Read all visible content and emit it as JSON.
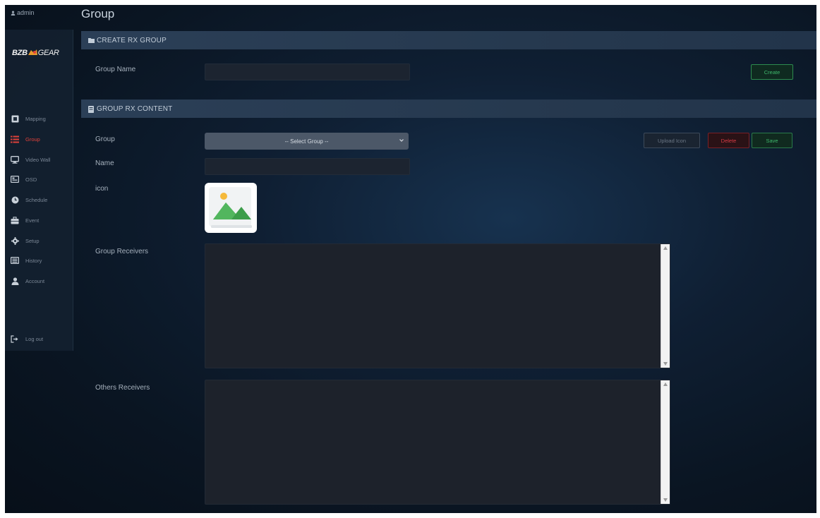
{
  "header": {
    "user": "admin",
    "page_title": "Group"
  },
  "brand": {
    "logo_part1": "BZB",
    "logo_part3": "GEAR"
  },
  "sidebar": {
    "items": [
      {
        "label": "Mapping",
        "icon": "mapping-icon"
      },
      {
        "label": "Group",
        "icon": "list-icon",
        "active": true
      },
      {
        "label": "Video Wall",
        "icon": "monitor-icon"
      },
      {
        "label": "OSD",
        "icon": "osd-icon"
      },
      {
        "label": "Schedule",
        "icon": "clock-icon"
      },
      {
        "label": "Event",
        "icon": "briefcase-icon"
      },
      {
        "label": "Setup",
        "icon": "gear-icon"
      },
      {
        "label": "History",
        "icon": "history-icon"
      },
      {
        "label": "Account",
        "icon": "user-icon"
      }
    ],
    "logout": "Log out"
  },
  "create_panel": {
    "title": "CREATE RX GROUP",
    "group_name_label": "Group Name",
    "group_name_value": "",
    "create_button": "Create"
  },
  "content_panel": {
    "title": "GROUP RX CONTENT",
    "group_label": "Group",
    "group_select": "-- Select Group --",
    "name_label": "Name",
    "name_value": "",
    "icon_label": "icon",
    "upload_button": "Upload Icon",
    "delete_button": "Delete",
    "save_button": "Save",
    "group_receivers_label": "Group Receivers",
    "others_receivers_label": "Others Receivers"
  },
  "colors": {
    "accent_active": "#e0413a",
    "create_green": "#3fb86c",
    "delete_red": "#d53a44",
    "panel_bar": "#2b3f57"
  }
}
